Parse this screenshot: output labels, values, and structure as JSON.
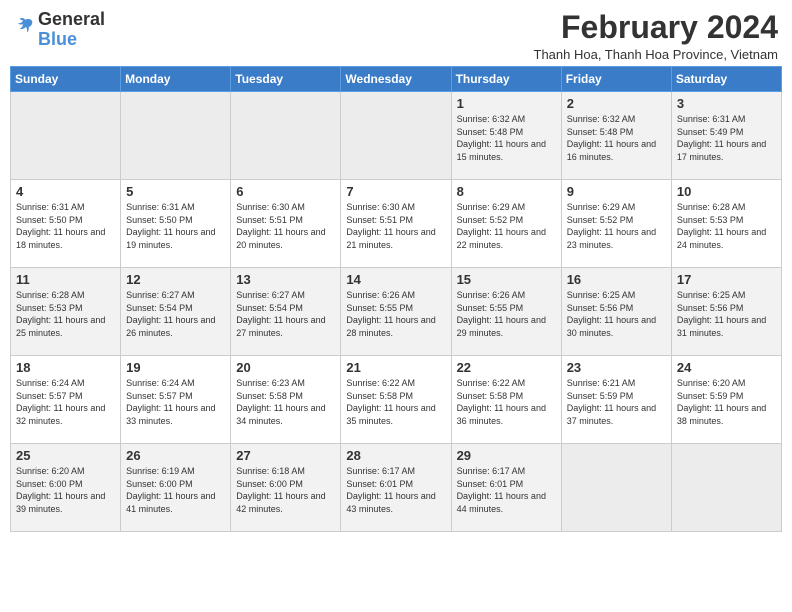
{
  "header": {
    "logo_line1": "General",
    "logo_line2": "Blue",
    "month_year": "February 2024",
    "location": "Thanh Hoa, Thanh Hoa Province, Vietnam"
  },
  "days_of_week": [
    "Sunday",
    "Monday",
    "Tuesday",
    "Wednesday",
    "Thursday",
    "Friday",
    "Saturday"
  ],
  "weeks": [
    [
      {
        "day": "",
        "info": ""
      },
      {
        "day": "",
        "info": ""
      },
      {
        "day": "",
        "info": ""
      },
      {
        "day": "",
        "info": ""
      },
      {
        "day": "1",
        "info": "Sunrise: 6:32 AM\nSunset: 5:48 PM\nDaylight: 11 hours and 15 minutes."
      },
      {
        "day": "2",
        "info": "Sunrise: 6:32 AM\nSunset: 5:48 PM\nDaylight: 11 hours and 16 minutes."
      },
      {
        "day": "3",
        "info": "Sunrise: 6:31 AM\nSunset: 5:49 PM\nDaylight: 11 hours and 17 minutes."
      }
    ],
    [
      {
        "day": "4",
        "info": "Sunrise: 6:31 AM\nSunset: 5:50 PM\nDaylight: 11 hours and 18 minutes."
      },
      {
        "day": "5",
        "info": "Sunrise: 6:31 AM\nSunset: 5:50 PM\nDaylight: 11 hours and 19 minutes."
      },
      {
        "day": "6",
        "info": "Sunrise: 6:30 AM\nSunset: 5:51 PM\nDaylight: 11 hours and 20 minutes."
      },
      {
        "day": "7",
        "info": "Sunrise: 6:30 AM\nSunset: 5:51 PM\nDaylight: 11 hours and 21 minutes."
      },
      {
        "day": "8",
        "info": "Sunrise: 6:29 AM\nSunset: 5:52 PM\nDaylight: 11 hours and 22 minutes."
      },
      {
        "day": "9",
        "info": "Sunrise: 6:29 AM\nSunset: 5:52 PM\nDaylight: 11 hours and 23 minutes."
      },
      {
        "day": "10",
        "info": "Sunrise: 6:28 AM\nSunset: 5:53 PM\nDaylight: 11 hours and 24 minutes."
      }
    ],
    [
      {
        "day": "11",
        "info": "Sunrise: 6:28 AM\nSunset: 5:53 PM\nDaylight: 11 hours and 25 minutes."
      },
      {
        "day": "12",
        "info": "Sunrise: 6:27 AM\nSunset: 5:54 PM\nDaylight: 11 hours and 26 minutes."
      },
      {
        "day": "13",
        "info": "Sunrise: 6:27 AM\nSunset: 5:54 PM\nDaylight: 11 hours and 27 minutes."
      },
      {
        "day": "14",
        "info": "Sunrise: 6:26 AM\nSunset: 5:55 PM\nDaylight: 11 hours and 28 minutes."
      },
      {
        "day": "15",
        "info": "Sunrise: 6:26 AM\nSunset: 5:55 PM\nDaylight: 11 hours and 29 minutes."
      },
      {
        "day": "16",
        "info": "Sunrise: 6:25 AM\nSunset: 5:56 PM\nDaylight: 11 hours and 30 minutes."
      },
      {
        "day": "17",
        "info": "Sunrise: 6:25 AM\nSunset: 5:56 PM\nDaylight: 11 hours and 31 minutes."
      }
    ],
    [
      {
        "day": "18",
        "info": "Sunrise: 6:24 AM\nSunset: 5:57 PM\nDaylight: 11 hours and 32 minutes."
      },
      {
        "day": "19",
        "info": "Sunrise: 6:24 AM\nSunset: 5:57 PM\nDaylight: 11 hours and 33 minutes."
      },
      {
        "day": "20",
        "info": "Sunrise: 6:23 AM\nSunset: 5:58 PM\nDaylight: 11 hours and 34 minutes."
      },
      {
        "day": "21",
        "info": "Sunrise: 6:22 AM\nSunset: 5:58 PM\nDaylight: 11 hours and 35 minutes."
      },
      {
        "day": "22",
        "info": "Sunrise: 6:22 AM\nSunset: 5:58 PM\nDaylight: 11 hours and 36 minutes."
      },
      {
        "day": "23",
        "info": "Sunrise: 6:21 AM\nSunset: 5:59 PM\nDaylight: 11 hours and 37 minutes."
      },
      {
        "day": "24",
        "info": "Sunrise: 6:20 AM\nSunset: 5:59 PM\nDaylight: 11 hours and 38 minutes."
      }
    ],
    [
      {
        "day": "25",
        "info": "Sunrise: 6:20 AM\nSunset: 6:00 PM\nDaylight: 11 hours and 39 minutes."
      },
      {
        "day": "26",
        "info": "Sunrise: 6:19 AM\nSunset: 6:00 PM\nDaylight: 11 hours and 41 minutes."
      },
      {
        "day": "27",
        "info": "Sunrise: 6:18 AM\nSunset: 6:00 PM\nDaylight: 11 hours and 42 minutes."
      },
      {
        "day": "28",
        "info": "Sunrise: 6:17 AM\nSunset: 6:01 PM\nDaylight: 11 hours and 43 minutes."
      },
      {
        "day": "29",
        "info": "Sunrise: 6:17 AM\nSunset: 6:01 PM\nDaylight: 11 hours and 44 minutes."
      },
      {
        "day": "",
        "info": ""
      },
      {
        "day": "",
        "info": ""
      }
    ]
  ]
}
